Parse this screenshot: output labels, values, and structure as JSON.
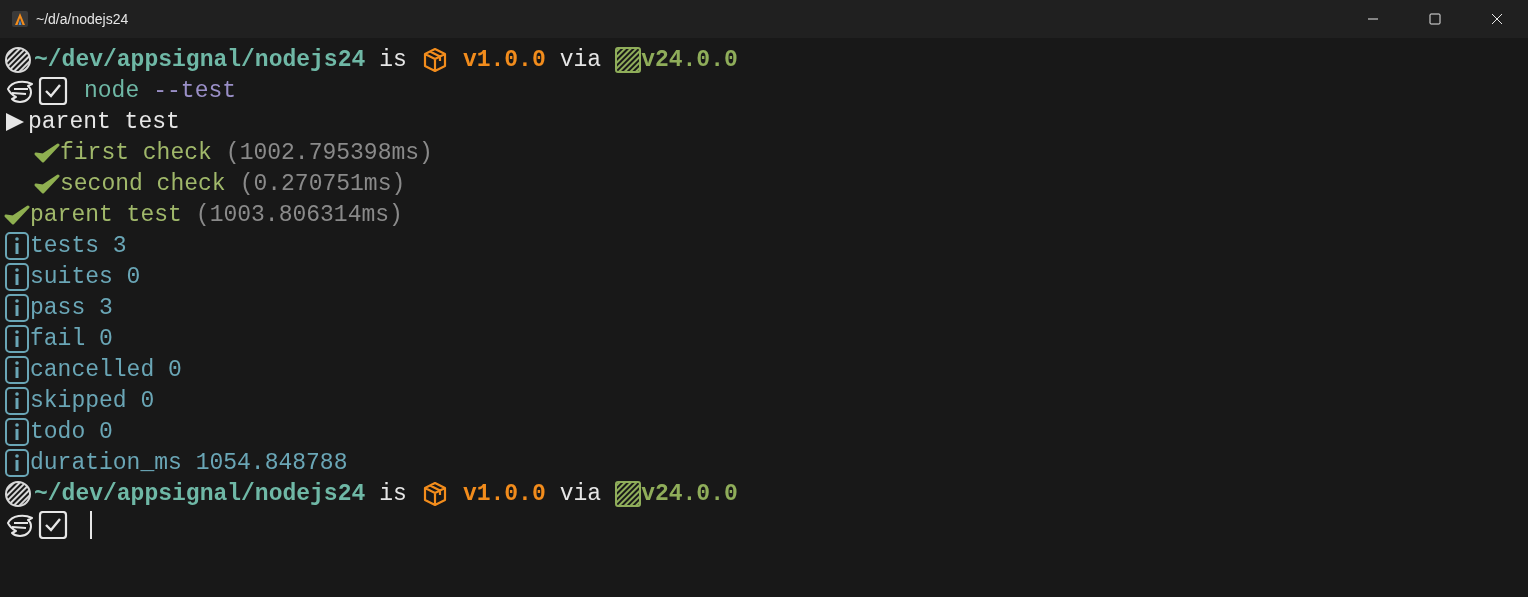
{
  "window": {
    "title": "~/d/a/nodejs24"
  },
  "lines": [
    {
      "kind": "prompt",
      "path": "~/dev/appsignal/nodejs24",
      "is": "is",
      "version": "v1.0.0",
      "via": "via",
      "node": "v24.0.0"
    },
    {
      "kind": "command",
      "program": "node",
      "args": "--test"
    },
    {
      "kind": "suite",
      "label": "parent test",
      "children": [
        {
          "kind": "pass",
          "label": "first check",
          "duration": "(1002.795398ms)"
        },
        {
          "kind": "pass",
          "label": "second check",
          "duration": "(0.270751ms)"
        }
      ]
    },
    {
      "kind": "pass",
      "label": "parent test",
      "duration": "(1003.806314ms)"
    },
    {
      "kind": "info",
      "label": "tests 3"
    },
    {
      "kind": "info",
      "label": "suites 0"
    },
    {
      "kind": "info",
      "label": "pass 3"
    },
    {
      "kind": "info",
      "label": "fail 0"
    },
    {
      "kind": "info",
      "label": "cancelled 0"
    },
    {
      "kind": "info",
      "label": "skipped 0"
    },
    {
      "kind": "info",
      "label": "todo 0"
    },
    {
      "kind": "info",
      "label": "duration_ms 1054.848788"
    },
    {
      "kind": "prompt",
      "path": "~/dev/appsignal/nodejs24",
      "is": "is",
      "version": "v1.0.0",
      "via": "via",
      "node": "v24.0.0"
    },
    {
      "kind": "input"
    }
  ]
}
